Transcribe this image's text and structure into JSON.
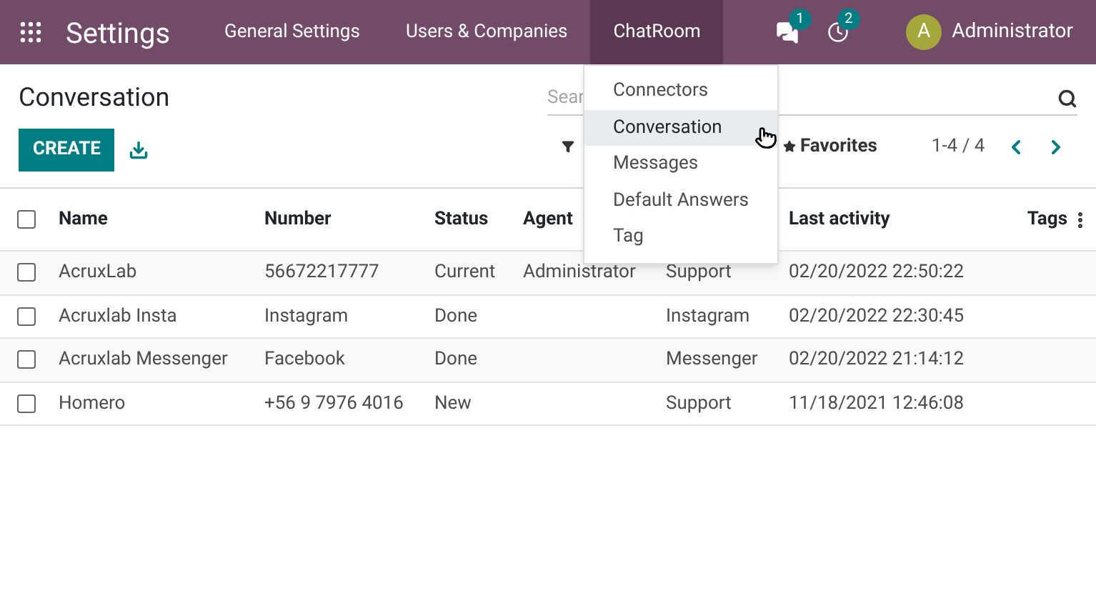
{
  "navbar": {
    "app_title": "Settings",
    "menu": [
      {
        "label": "General Settings",
        "selected": false
      },
      {
        "label": "Users & Companies",
        "selected": false
      },
      {
        "label": "ChatRoom",
        "selected": true
      }
    ],
    "chat_badge": "1",
    "activity_badge": "2",
    "user": {
      "avatar_letter": "A",
      "name": "Administrator"
    }
  },
  "dropdown": {
    "items": [
      {
        "label": "Connectors",
        "selected": false
      },
      {
        "label": "Conversation",
        "selected": true
      },
      {
        "label": "Messages",
        "selected": false
      },
      {
        "label": "Default Answers",
        "selected": false
      },
      {
        "label": "Tag",
        "selected": false
      }
    ]
  },
  "page": {
    "title": "Conversation",
    "create_button": "CREATE",
    "search": {
      "placeholder": "Sear"
    },
    "favorites_label": "Favorites",
    "pager": "1-4 / 4"
  },
  "table": {
    "header_checked": false,
    "columns": [
      "Name",
      "Number",
      "Status",
      "Agent",
      null,
      "Last activity",
      "Tags"
    ],
    "rows": [
      {
        "checked": false,
        "cells": [
          "AcruxLab",
          "56672217777",
          "Current",
          "Administrator",
          "Support",
          "02/20/2022 22:50:22",
          null
        ]
      },
      {
        "checked": false,
        "cells": [
          "Acruxlab Insta",
          "Instagram",
          "Done",
          null,
          "Instagram",
          "02/20/2022 22:30:45",
          null
        ]
      },
      {
        "checked": false,
        "cells": [
          "Acruxlab Messenger",
          "Facebook",
          "Done",
          null,
          "Messenger",
          "02/20/2022 21:14:12",
          null
        ]
      },
      {
        "checked": false,
        "cells": [
          "Homero",
          "+56 9 7976 4016",
          "New",
          null,
          "Support",
          "11/18/2021 12:46:08",
          null
        ]
      }
    ]
  }
}
